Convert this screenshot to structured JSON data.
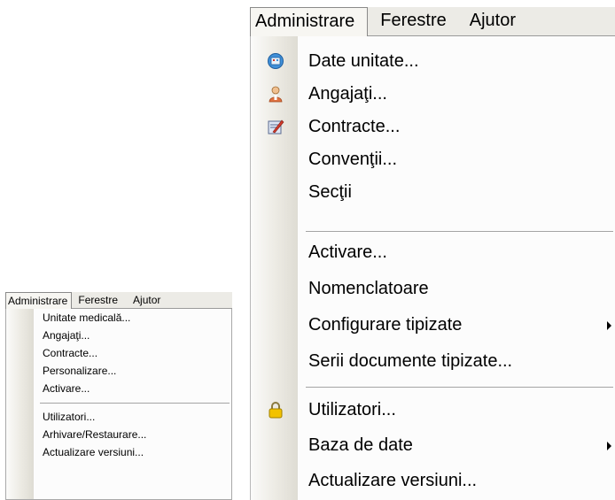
{
  "large_menu": {
    "menubar": [
      "Administrare",
      "Ferestre",
      "Ajutor"
    ],
    "items": [
      {
        "label": "Date unitate...",
        "icon": "building-info-icon"
      },
      {
        "label": "Angajaţi...",
        "icon": "person-icon"
      },
      {
        "label": "Contracte...",
        "icon": "document-edit-icon"
      },
      {
        "label": "Convenţii..."
      },
      {
        "label": "Secţii"
      },
      {
        "label": "Activare..."
      },
      {
        "label": "Nomenclatoare"
      },
      {
        "label": "Configurare tipizate",
        "submenu": true
      },
      {
        "label": "Serii documente tipizate..."
      },
      {
        "label": "Utilizatori...",
        "icon": "lock-icon"
      },
      {
        "label": "Baza de date",
        "submenu": true
      },
      {
        "label": "Actualizare versiuni..."
      }
    ]
  },
  "small_menu": {
    "menubar": [
      "Administrare",
      "Ferestre",
      "Ajutor"
    ],
    "items": [
      {
        "label": "Unitate medicală..."
      },
      {
        "label": "Angajaţi..."
      },
      {
        "label": "Contracte..."
      },
      {
        "label": "Personalizare..."
      },
      {
        "label": "Activare..."
      },
      {
        "label": "Utilizatori..."
      },
      {
        "label": "Arhivare/Restaurare..."
      },
      {
        "label": "Actualizare versiuni..."
      }
    ]
  },
  "colors": {
    "menubar_bg": "#ecebe6",
    "panel_bg": "#fcfcfc",
    "lock_icon": "#e8b400",
    "info_icon": "#3f8fd8"
  }
}
